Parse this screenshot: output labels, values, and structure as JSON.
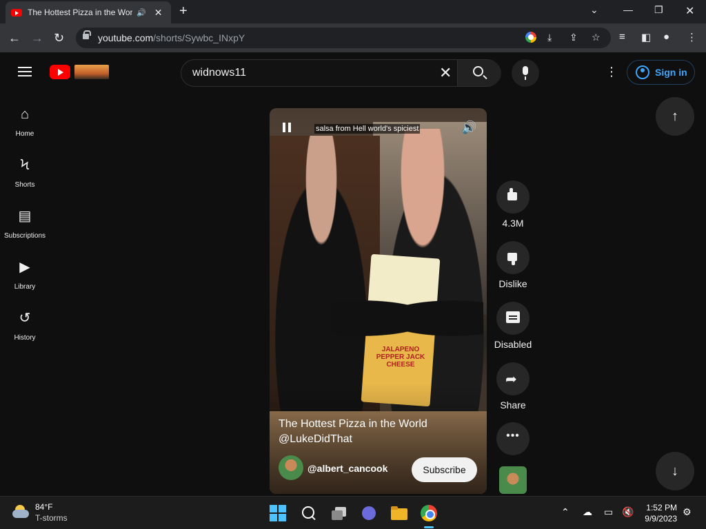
{
  "browser": {
    "tab_title": "The Hottest Pizza in the Worl",
    "audio_icon": "speaker-icon",
    "url_host": "youtube.com",
    "url_path": "/shorts/Sywbc_INxpY"
  },
  "youtube": {
    "search_value": "widnows11",
    "signin_label": "Sign in",
    "sidebar": [
      {
        "label": "Home",
        "icon": "home-icon"
      },
      {
        "label": "Shorts",
        "icon": "shorts-icon"
      },
      {
        "label": "Subscriptions",
        "icon": "subscriptions-icon"
      },
      {
        "label": "Library",
        "icon": "library-icon"
      },
      {
        "label": "History",
        "icon": "history-icon"
      }
    ]
  },
  "short": {
    "caption": "salsa from Hell world's spiciest",
    "title_line1": "The Hottest Pizza in the World",
    "title_line2": "@LukeDidThat",
    "channel": "@albert_cancook",
    "subscribe_label": "Subscribe",
    "cheese_label": "JALAPENO PEPPER JACK CHEESE"
  },
  "actions": {
    "likes": "4.3M",
    "dislike": "Dislike",
    "comments": "Disabled",
    "share": "Share"
  },
  "taskbar": {
    "temp": "84°F",
    "condition": "T-storms",
    "time": "1:52 PM",
    "date": "9/9/2023"
  },
  "colors": {
    "accent": "#3ea6ff",
    "brand": "#ff0000",
    "background": "#0f0f0f"
  }
}
